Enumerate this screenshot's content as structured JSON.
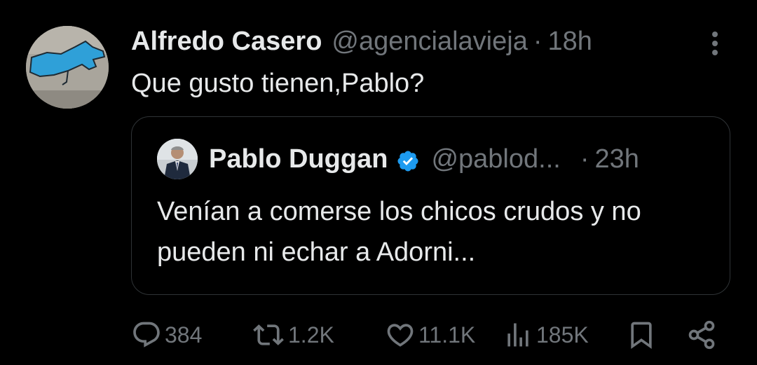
{
  "tweet": {
    "author_name": "Alfredo Casero",
    "author_handle": "@agencialavieja",
    "separator": "·",
    "time": "18h",
    "text": "Que gusto tienen,Pablo?"
  },
  "quoted_tweet": {
    "author_name": "Pablo Duggan",
    "verified": true,
    "author_handle": "@pablod...",
    "separator": "·",
    "time": "23h",
    "text": "Venían a comerse los chicos crudos y no pueden ni echar a Adorni..."
  },
  "actions": {
    "replies": "384",
    "reposts": "1.2K",
    "likes": "11.1K",
    "views": "185K"
  },
  "icons": {
    "reply": "reply-icon",
    "repost": "repost-icon",
    "like": "heart-icon",
    "views": "views-icon",
    "bookmark": "bookmark-icon",
    "share": "share-icon",
    "more": "more-icon",
    "verified": "verified-badge-icon"
  },
  "colors": {
    "background": "#000000",
    "text_primary": "#e7e9ea",
    "text_secondary": "#71767b",
    "border": "#2f3336",
    "verified_blue": "#1d9bf0"
  }
}
